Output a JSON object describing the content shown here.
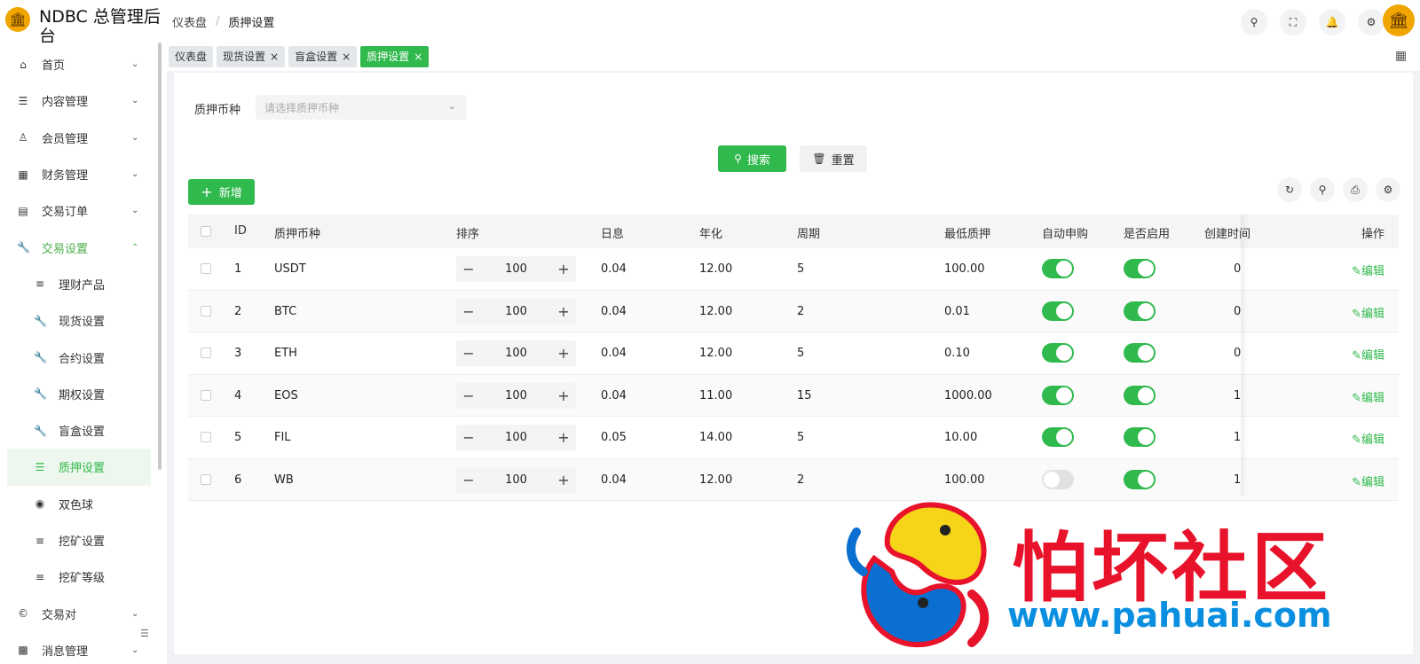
{
  "app": {
    "title": "NDBC 总管理后台"
  },
  "breadcrumb": [
    "仪表盘",
    "质押设置"
  ],
  "sidebar": {
    "items": [
      {
        "label": "首页",
        "icon": "home-icon",
        "glyph": "⌂",
        "arrow": "⌄"
      },
      {
        "label": "内容管理",
        "icon": "list-icon",
        "glyph": "☰",
        "arrow": "⌄"
      },
      {
        "label": "会员管理",
        "icon": "user-icon",
        "glyph": "♙",
        "arrow": "⌄"
      },
      {
        "label": "财务管理",
        "icon": "table-icon",
        "glyph": "▦",
        "arrow": "⌄"
      },
      {
        "label": "交易订单",
        "icon": "order-icon",
        "glyph": "▤",
        "arrow": "⌄"
      },
      {
        "label": "交易设置",
        "icon": "wrench-icon",
        "glyph": "🔧",
        "arrow": "⌃"
      }
    ],
    "subitems": [
      {
        "label": "理财产品",
        "icon": "lines-icon",
        "glyph": "≡"
      },
      {
        "label": "现货设置",
        "icon": "wrench-icon",
        "glyph": "🔧"
      },
      {
        "label": "合约设置",
        "icon": "wrench-icon",
        "glyph": "🔧"
      },
      {
        "label": "期权设置",
        "icon": "wrench-icon",
        "glyph": "🔧"
      },
      {
        "label": "盲盒设置",
        "icon": "wrench-icon",
        "glyph": "🔧"
      },
      {
        "label": "质押设置",
        "icon": "list-icon",
        "glyph": "☰"
      },
      {
        "label": "双色球",
        "icon": "target-icon",
        "glyph": "◉"
      },
      {
        "label": "挖矿设置",
        "icon": "lines-icon",
        "glyph": "≡"
      },
      {
        "label": "挖矿等级",
        "icon": "lines-icon",
        "glyph": "≡"
      }
    ],
    "bottom_items": [
      {
        "label": "交易对",
        "icon": "copyright-icon",
        "glyph": "©",
        "arrow": "⌄"
      },
      {
        "label": "消息管理",
        "icon": "message-icon",
        "glyph": "▩",
        "arrow": "⌄"
      }
    ]
  },
  "header_icons": [
    {
      "name": "search-icon",
      "glyph": "⚲"
    },
    {
      "name": "fullscreen-icon",
      "glyph": "⛶"
    },
    {
      "name": "bell-icon",
      "glyph": "🔔"
    },
    {
      "name": "gear-icon",
      "glyph": "⚙"
    }
  ],
  "tabs": [
    {
      "label": "仪表盘",
      "closable": false
    },
    {
      "label": "现货设置",
      "closable": true
    },
    {
      "label": "盲盒设置",
      "closable": true
    },
    {
      "label": "质押设置",
      "closable": true,
      "active": true
    }
  ],
  "filter": {
    "label": "质押币种",
    "placeholder": "请选择质押币种"
  },
  "buttons": {
    "search": "搜索",
    "reset": "重置",
    "add": "新增",
    "edit": "编辑"
  },
  "table": {
    "columns": [
      "ID",
      "质押币种",
      "排序",
      "日息",
      "年化",
      "周期",
      "最低质押",
      "自动申购",
      "是否启用",
      "创建时间",
      "操作"
    ],
    "rows": [
      {
        "id": "1",
        "coin": "USDT",
        "sort": "100",
        "daily": "0.04",
        "annual": "12.00",
        "period": "5",
        "min": "100.00",
        "auto": true,
        "enabled": true,
        "created": "0"
      },
      {
        "id": "2",
        "coin": "BTC",
        "sort": "100",
        "daily": "0.04",
        "annual": "12.00",
        "period": "2",
        "min": "0.01",
        "auto": true,
        "enabled": true,
        "created": "0"
      },
      {
        "id": "3",
        "coin": "ETH",
        "sort": "100",
        "daily": "0.04",
        "annual": "12.00",
        "period": "5",
        "min": "0.10",
        "auto": true,
        "enabled": true,
        "created": "0"
      },
      {
        "id": "4",
        "coin": "EOS",
        "sort": "100",
        "daily": "0.04",
        "annual": "11.00",
        "period": "15",
        "min": "1000.00",
        "auto": true,
        "enabled": true,
        "created": "1"
      },
      {
        "id": "5",
        "coin": "FIL",
        "sort": "100",
        "daily": "0.05",
        "annual": "14.00",
        "period": "5",
        "min": "10.00",
        "auto": true,
        "enabled": true,
        "created": "1"
      },
      {
        "id": "6",
        "coin": "WB",
        "sort": "100",
        "daily": "0.04",
        "annual": "12.00",
        "period": "2",
        "min": "100.00",
        "auto": false,
        "enabled": true,
        "created": "1"
      }
    ]
  },
  "watermark": {
    "title": "怕坏社区",
    "url": "www.pahuai.com"
  },
  "colors": {
    "primary": "#30b94d",
    "watermark_red": "#e8132a",
    "watermark_blue": "#0a8fe0"
  }
}
